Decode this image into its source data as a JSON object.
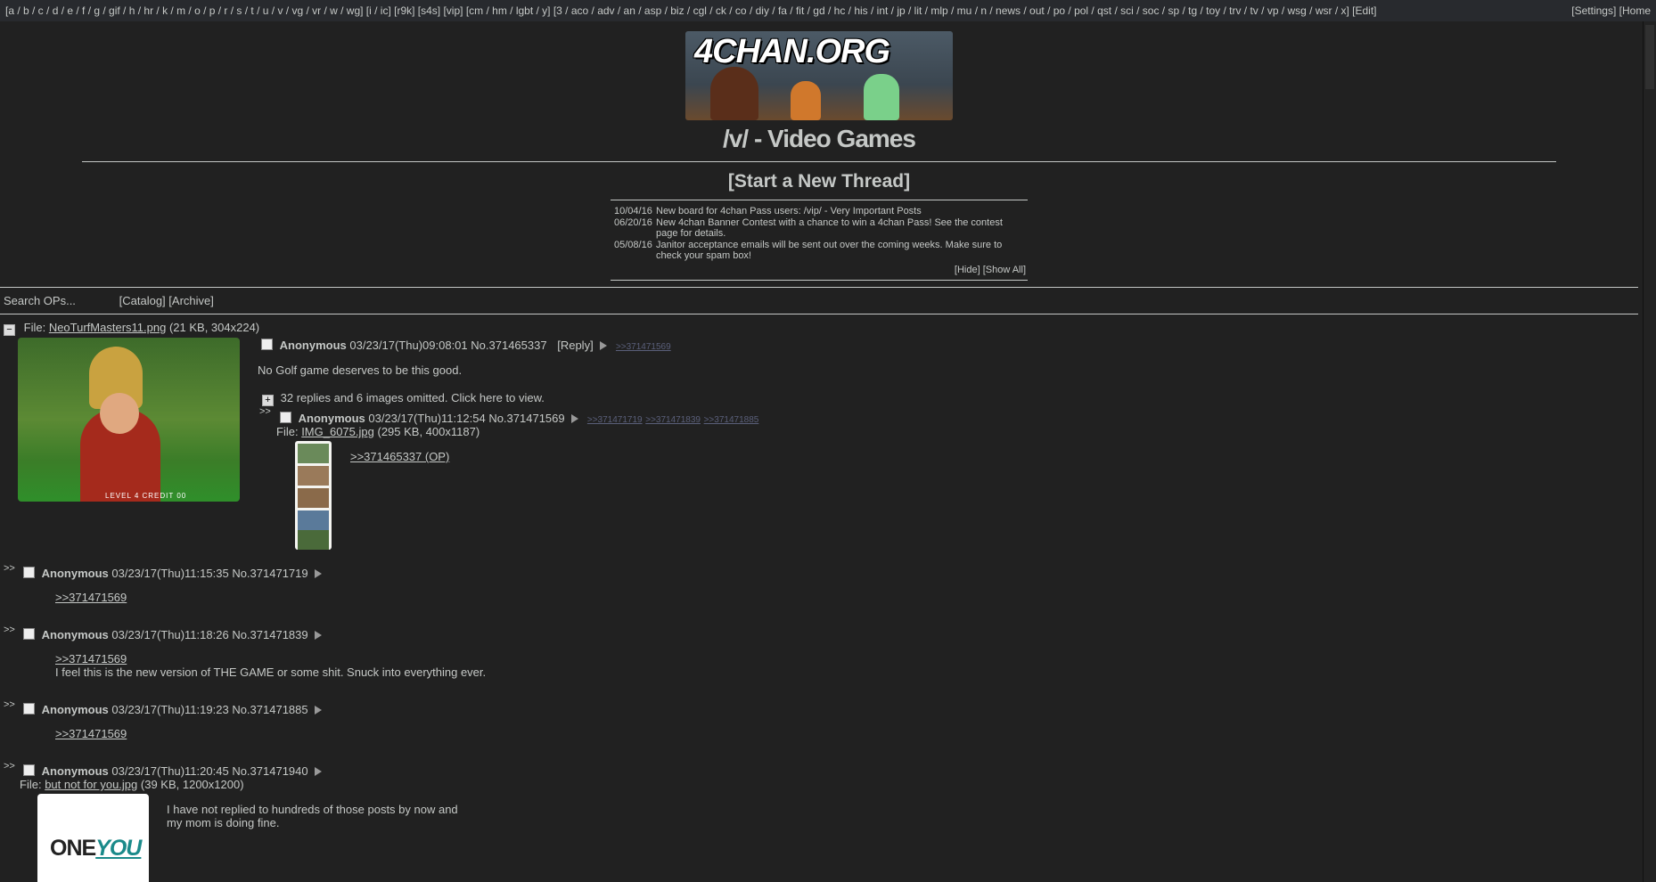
{
  "topnav": {
    "boards": "[a / b / c / d / e / f / g / gif / h / hr / k / m / o / p / r / s / t / u / v / vg / vr / w / wg] [i / ic] [r9k] [s4s] [vip] [cm / hm / lgbt / y] [3 / aco / adv / an / asp / biz / cgl / ck / co / diy / fa / fit / gd / hc / his / int / jp / lit / mlp / mu / n / news / out / po / pol / qst / sci / soc / sp / tg / toy / trv / tv / vp / wsg / wsr / x] [Edit]",
    "right": "[Settings] [Home"
  },
  "banner": {
    "logo_text": "4CHAN.ORG"
  },
  "board_title": "/v/ - Video Games",
  "new_thread": "[Start a New Thread]",
  "news": [
    {
      "date": "10/04/16",
      "msg": "New board for 4chan Pass users: /vip/ - Very Important Posts"
    },
    {
      "date": "06/20/16",
      "msg": "New 4chan Banner Contest with a chance to win a 4chan Pass! See the contest page for details."
    },
    {
      "date": "05/08/16",
      "msg": "Janitor acceptance emails will be sent out over the coming weeks. Make sure to check your spam box!"
    }
  ],
  "news_actions": "[Hide] [Show All]",
  "searchbar": {
    "search_placeholder": "Search OPs...",
    "catalog": "[Catalog]",
    "archive": "[Archive]"
  },
  "op": {
    "file_label": "File:",
    "file_name": "NeoTurfMasters11.png",
    "file_info": "(21 KB, 304x224)",
    "name": "Anonymous",
    "datetime": "03/23/17(Thu)09:08:01",
    "no": "No.371465337",
    "reply_link": "[Reply]",
    "backlink": ">>371471569",
    "comment": "No Golf game deserves to be this good.",
    "omitted": "32 replies and 6 images omitted. Click here to view.",
    "image_hud": "LEVEL 4   CREDIT  00"
  },
  "replies": [
    {
      "name": "Anonymous",
      "datetime": "03/23/17(Thu)11:12:54",
      "no": "No.371471569",
      "backlinks": [
        ">>371471719",
        ">>371471839",
        ">>371471885"
      ],
      "file_label": "File:",
      "file_name": "IMG_6075.jpg",
      "file_info": "(295 KB, 400x1187)",
      "quote": ">>371465337 (OP)"
    },
    {
      "name": "Anonymous",
      "datetime": "03/23/17(Thu)11:15:35",
      "no": "No.371471719",
      "quote": ">>371471569",
      "text": ""
    },
    {
      "name": "Anonymous",
      "datetime": "03/23/17(Thu)11:18:26",
      "no": "No.371471839",
      "quote": ">>371471569",
      "text": "I feel this is the new version of THE GAME or some shit. Snuck into everything ever."
    },
    {
      "name": "Anonymous",
      "datetime": "03/23/17(Thu)11:19:23",
      "no": "No.371471885",
      "quote": ">>371471569",
      "text": ""
    },
    {
      "name": "Anonymous",
      "datetime": "03/23/17(Thu)11:20:45",
      "no": "No.371471940",
      "file_label": "File:",
      "file_name": "but not for you.jpg",
      "file_info": "(39 KB, 1200x1200)",
      "text1": "I have not replied to hundreds of those posts by now and",
      "text2": "my mom is doing fine.",
      "image_text_a": "ONE",
      "image_text_b": "YOU"
    }
  ],
  "quote_marker": ">>"
}
